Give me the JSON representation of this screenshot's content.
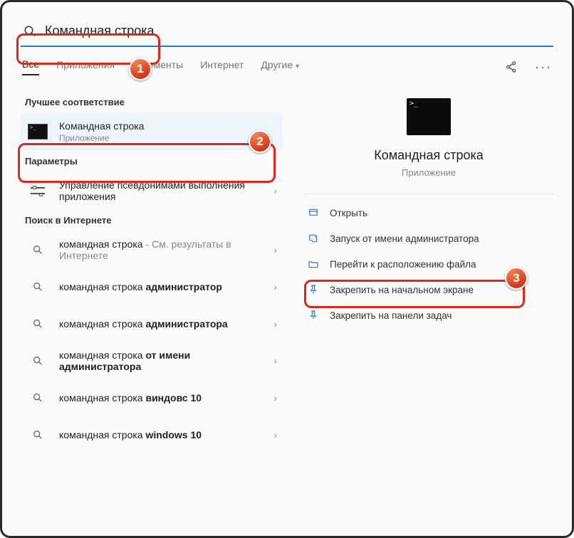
{
  "search": {
    "value": "Командная строка"
  },
  "tabs": {
    "all": "Все",
    "apps": "Приложения",
    "docs": "Документы",
    "internet": "Интернет",
    "more": "Другие"
  },
  "left": {
    "best_match_label": "Лучшее соответствие",
    "best_match": {
      "title": "Командная строка",
      "subtitle": "Приложение"
    },
    "settings_label": "Параметры",
    "settings_item": "Управление псевдонимами выполнения приложения",
    "web_label": "Поиск в Интернете",
    "web": [
      {
        "prefix": "командная строка",
        "suffix": "См. результаты в Интернете"
      },
      {
        "prefix": "командная строка ",
        "bold": "администратор"
      },
      {
        "prefix": "командная строка ",
        "bold": "администратора"
      },
      {
        "prefix": "командная строка ",
        "bold": "от имени администратора"
      },
      {
        "prefix": "командная строка ",
        "bold": "виндовс 10"
      },
      {
        "prefix": "командная строка ",
        "bold": "windows 10"
      }
    ]
  },
  "right": {
    "title": "Командная строка",
    "subtitle": "Приложение",
    "actions": {
      "open": "Открыть",
      "run_admin": "Запуск от имени администратора",
      "open_location": "Перейти к расположению файла",
      "pin_start": "Закрепить на начальном экране",
      "pin_taskbar": "Закрепить на панели задач"
    }
  },
  "annotations": {
    "b1": "1",
    "b2": "2",
    "b3": "3"
  }
}
